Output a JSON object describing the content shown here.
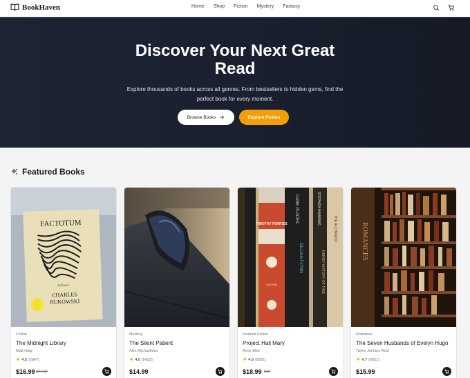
{
  "brand": {
    "name": "BookHaven"
  },
  "nav": [
    "Home",
    "Shop",
    "Fiction",
    "Mystery",
    "Fantasy"
  ],
  "header_icons": [
    "search-icon",
    "cart-icon"
  ],
  "hero": {
    "title": "Discover Your Next Great Read",
    "subtitle": "Explore thousands of books across all genres. From bestsellers to hidden gems, find the perfect book for every moment.",
    "primary_button": "Browse Books",
    "secondary_button": "Explore Fiction"
  },
  "featured": {
    "heading": "Featured Books",
    "books": [
      {
        "genre": "Fiction",
        "title": "The Midnight Library",
        "author": "Matt Haig",
        "rating": "4.5",
        "count": "(2847)",
        "price": "$16.99",
        "old_price": "$24.99"
      },
      {
        "genre": "Mystery",
        "title": "The Silent Patient",
        "author": "Alex Michaelides",
        "rating": "4.6",
        "count": "(5432)",
        "price": "$14.99",
        "old_price": ""
      },
      {
        "genre": "Science Fiction",
        "title": "Project Hail Mary",
        "author": "Andy Weir",
        "rating": "4.9",
        "count": "(9921)",
        "price": "$18.99",
        "old_price": "$28"
      },
      {
        "genre": "Romance",
        "title": "The Seven Husbands of Evelyn Hugo",
        "author": "Taylor Jenkins Reid",
        "rating": "4.7",
        "count": "(6821)",
        "price": "$15.99",
        "old_price": ""
      }
    ]
  },
  "cover_text": {
    "factotum_title": "FACTOTUM",
    "factotum_sub": "A Novel",
    "factotum_author1": "CHARLES",
    "factotum_author2": "BUKOWSKI",
    "spine_romances": "ROMANCES",
    "spine_dark_places": "DARK PLACES",
    "spine_flynn": "GILLIAN FLYNN",
    "spine_hawking": "STEPHEN HAWKING",
    "spine_history": "A BRIEF HISTORY OF TIME",
    "spine_ferriss": "TIMOTHY FERRISS",
    "spine_crown": "CROWN",
    "spine_alchemist": "THE ALCHEMIST"
  },
  "colors": {
    "accent": "#f59e0b",
    "hero_bg": "#1e2433",
    "dark": "#18181b"
  }
}
